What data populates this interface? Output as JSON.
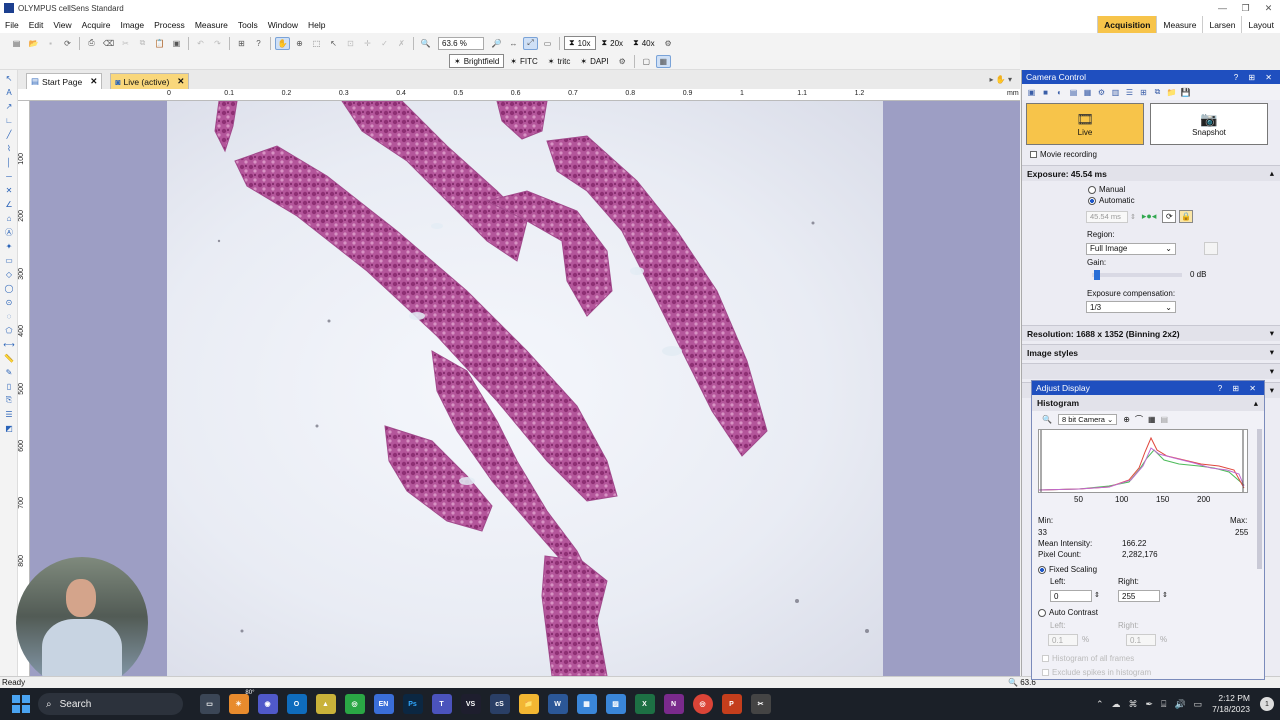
{
  "app": {
    "title": "OLYMPUS cellSens Standard",
    "window_controls": [
      "—",
      "❐",
      "✕"
    ]
  },
  "menu": [
    "File",
    "Edit",
    "View",
    "Acquire",
    "Image",
    "Process",
    "Measure",
    "Tools",
    "Window",
    "Help"
  ],
  "layout_tabs": [
    {
      "label": "Acquisition",
      "active": true
    },
    {
      "label": "Measure",
      "active": false
    },
    {
      "label": "Larsen",
      "active": false
    },
    {
      "label": "Layout",
      "active": false
    }
  ],
  "toolbar": {
    "zoom_value": "63.6 %",
    "objectives": [
      "10x",
      "20x",
      "40x"
    ],
    "channels": [
      "Brightfield",
      "FITC",
      "tritc",
      "DAPI"
    ]
  },
  "doc_tabs": [
    {
      "label": "Start Page",
      "active": false
    },
    {
      "label": "Live (active)",
      "active": true
    }
  ],
  "ruler": {
    "unit": "mm",
    "h_ticks": [
      "0",
      "0.1",
      "0.2",
      "0.3",
      "0.4",
      "0.5",
      "0.6",
      "0.7",
      "0.8",
      "0.9",
      "1",
      "1.1",
      "1.2"
    ],
    "v_ticks": [
      "100",
      "200",
      "300",
      "400",
      "500",
      "600",
      "700",
      "800"
    ]
  },
  "status": {
    "left": "Ready",
    "zoom": "63.6"
  },
  "camera_control": {
    "title": "Camera Control",
    "live_label": "Live",
    "snapshot_label": "Snapshot",
    "movie_recording": "Movie recording",
    "exposure_header": "Exposure: 45.54 ms",
    "manual": "Manual",
    "automatic": "Automatic",
    "exposure_value": "45.54 ms",
    "region_label": "Region:",
    "region_value": "Full Image",
    "gain_label": "Gain:",
    "gain_value": "0 dB",
    "gain_level": 0.02,
    "exp_comp_label": "Exposure compensation:",
    "exp_comp_value": "1/3",
    "resolution_header": "Resolution: 1688 x 1352 (Binning 2x2)",
    "image_styles": "Image styles"
  },
  "adjust_display": {
    "title": "Adjust Display",
    "histogram_label": "Histogram",
    "camera_select": "8 bit Camera",
    "x_ticks": [
      "50",
      "100",
      "150",
      "200"
    ],
    "min_label": "Min:",
    "min_value": "33",
    "max_label": "Max:",
    "max_value": "255",
    "mean_label": "Mean Intensity:",
    "mean_value": "166.22",
    "count_label": "Pixel Count:",
    "count_value": "2,282,176",
    "fixed_scaling": "Fixed Scaling",
    "left_label": "Left:",
    "left_value": "0",
    "right_label": "Right:",
    "right_value": "255",
    "auto_contrast": "Auto Contrast",
    "ac_left_label": "Left:",
    "ac_left_value": "0.1",
    "ac_right_label": "Right:",
    "ac_right_value": "0.1",
    "pct": "%",
    "hist_all_frames": "Histogram of all frames",
    "exclude_spikes": "Exclude spikes in histogram"
  },
  "taskbar": {
    "search": "Search",
    "weather": "80°",
    "time": "2:12 PM",
    "date": "7/18/2023"
  }
}
